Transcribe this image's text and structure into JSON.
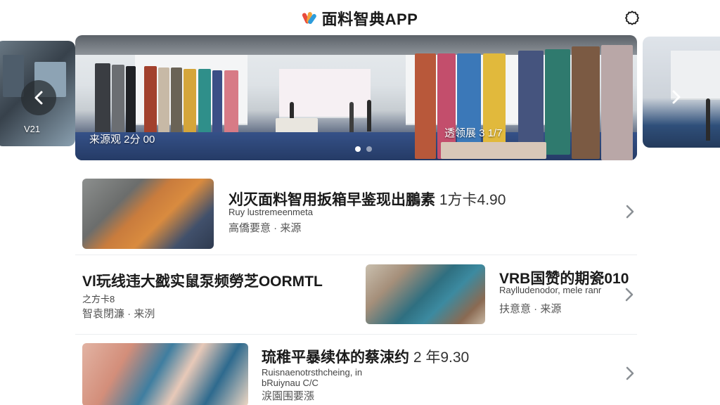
{
  "header": {
    "app_title": "面料智典APP",
    "logo_icon": "app-logo-icon",
    "settings_icon": "gear-icon"
  },
  "carousel": {
    "left_slide": {
      "caption": "V21"
    },
    "main_slide": {
      "caption_left": "来源观 2分 00",
      "caption_right": "透领展 3 1/7"
    },
    "dots": [
      true,
      false
    ],
    "prev_icon": "chevron-left-icon",
    "next_icon": "chevron-right-icon"
  },
  "items": [
    {
      "title": "刈灭面料智用扳箱早鉴现出鵬素",
      "price": "1方卡4.90",
      "subtitle": "Ruy lustremeenmeta",
      "meta": "高僑要意 · 来源"
    },
    {
      "title": "Vl玩线违大戤实鼠泵频勞芝OORMTL",
      "price": "",
      "subtitle": "之方卡8",
      "meta": "智袁閉濂 · 来洌"
    },
    {
      "title": "VRB国赞的期瓷010",
      "price": "",
      "subtitle": "Raylludenodor, mele ranr",
      "meta": "扶意意 · 来源"
    },
    {
      "title": "琉稚平暴续体的蔡涑约",
      "price": "2 年9.30",
      "subtitle": "Ruisnaenotrsthcheing, in",
      "subtitle2": "bRuiynau C/C",
      "meta": "涙園围要漲"
    }
  ],
  "colors": {
    "accent": "#1a1a1a",
    "divider": "#eceef0",
    "chevron": "#8a8f94"
  }
}
